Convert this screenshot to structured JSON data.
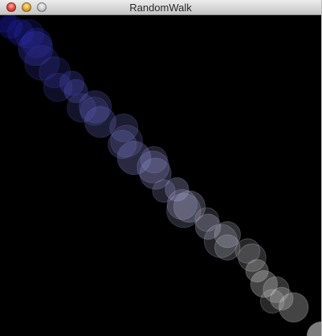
{
  "window": {
    "title": "RandomWalk",
    "controls": [
      "close",
      "minimize",
      "zoom"
    ]
  },
  "canvas": {
    "background": "#000000",
    "start_color": "#1a1ab4",
    "end_color": "#dcdcdc",
    "trail_length": 40
  },
  "icons": {
    "close": "close-icon",
    "minimize": "minimize-icon",
    "zoom": "zoom-icon",
    "resize": "resize-grip-icon"
  }
}
